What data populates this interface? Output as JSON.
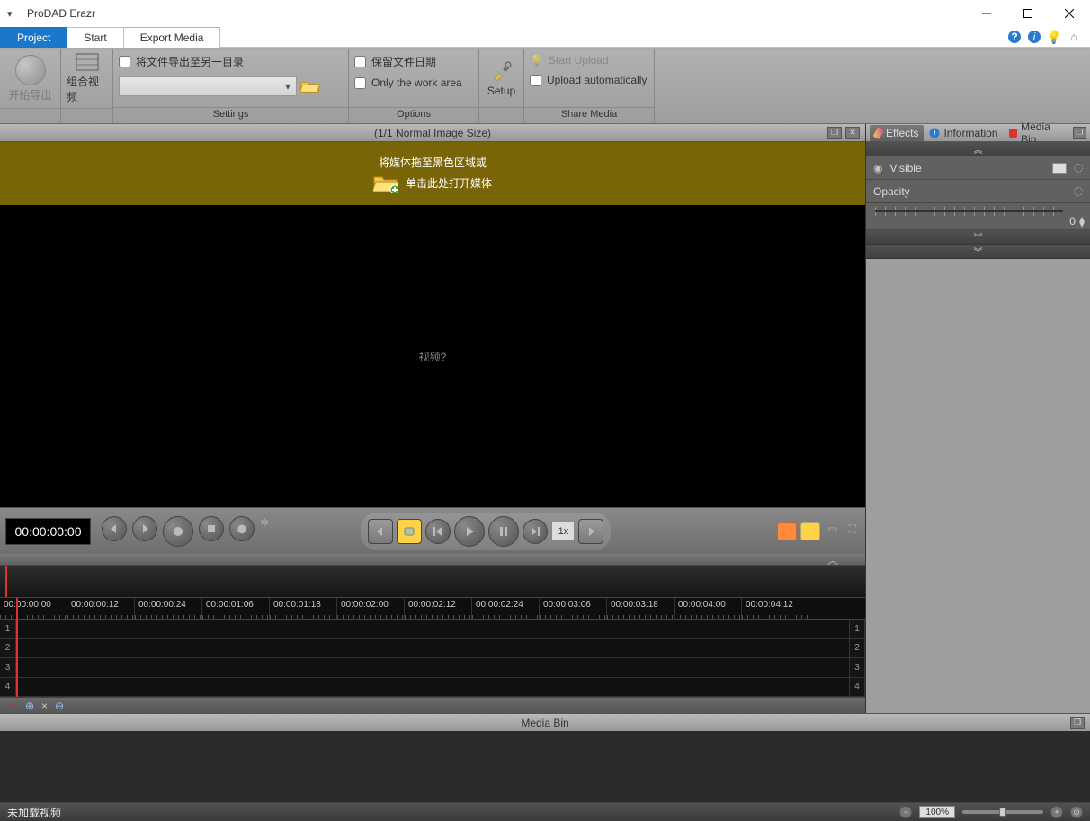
{
  "titlebar": {
    "app_title": "ProDAD Erazr"
  },
  "tabs": {
    "project": "Project",
    "start": "Start",
    "export": "Export Media"
  },
  "ribbon": {
    "start_export": "开始导出",
    "combine_video": "组合视频",
    "export_to_other_dir": "将文件导出至另一目录",
    "settings_label": "Settings",
    "keep_file_date": "保留文件日期",
    "only_work_area": "Only the work area",
    "options_label": "Options",
    "setup": "Setup",
    "start_upload": "Start Upload",
    "upload_auto": "Upload automatically",
    "share_label": "Share Media"
  },
  "viewer": {
    "header": "(1/1  Normal Image Size)",
    "drop_line1": "将媒体拖至黑色区域或",
    "drop_line2": "单击此处打开媒体",
    "placeholder": "视频?"
  },
  "transport": {
    "timecode": "00:00:00:00",
    "speed": "1x"
  },
  "timeline": {
    "ticks": [
      "00:00:00:00",
      "00:00:00:12",
      "00:00:00:24",
      "00:00:01:06",
      "00:00:01:18",
      "00:00:02:00",
      "00:00:02:12",
      "00:00:02:24",
      "00:00:03:06",
      "00:00:03:18",
      "00:00:04:00",
      "00:00:04:12"
    ],
    "tracks": [
      "1",
      "2",
      "3",
      "4"
    ]
  },
  "right": {
    "effects": "Effects",
    "information": "Information",
    "mediabin": "Media Bin",
    "visible": "Visible",
    "opacity": "Opacity",
    "opacity_val": "0"
  },
  "mediabin": {
    "title": "Media Bin"
  },
  "status": {
    "text": "未加载视频",
    "zoom": "100%"
  }
}
